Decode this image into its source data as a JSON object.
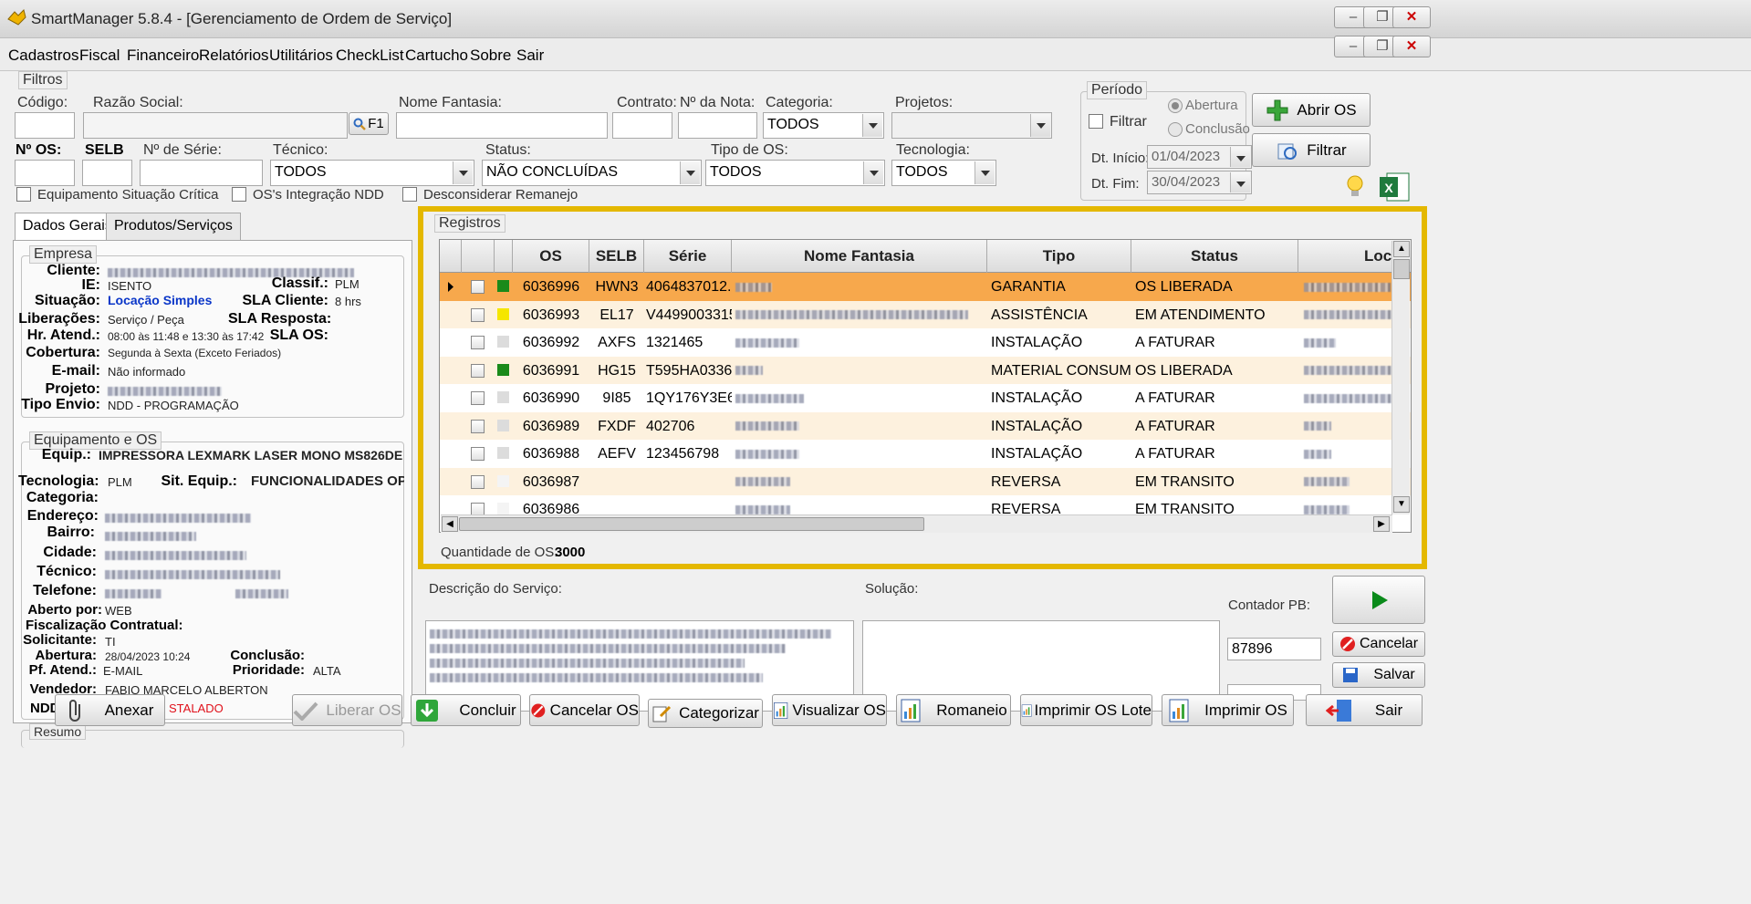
{
  "window": {
    "title": "SmartManager 5.8.4 - [Gerenciamento de Ordem de Serviço]",
    "minimize": "–",
    "restore": "❐",
    "close": "✕"
  },
  "menu": [
    "Cadastros",
    "Fiscal",
    "Financeiro",
    "Relatórios",
    "Utilitários",
    "CheckList",
    "Cartucho",
    "Sobre",
    "Sair"
  ],
  "filters": {
    "legend": "Filtros",
    "codigo_label": "Código:",
    "razao_label": "Razão Social:",
    "f1_label": "F1",
    "fantasia_label": "Nome Fantasia:",
    "contrato_label": "Contrato:",
    "nota_label": "Nº da Nota:",
    "categoria_label": "Categoria:",
    "categoria_value": "TODOS",
    "projetos_label": "Projetos:",
    "nos_label": "Nº OS:",
    "selb_label": "SELB",
    "serie_label": "Nº de Série:",
    "tecnico_label": "Técnico:",
    "tecnico_value": "TODOS",
    "status_label": "Status:",
    "status_value": "NÃO CONCLUÍDAS",
    "tipo_label": "Tipo de OS:",
    "tipo_value": "TODOS",
    "tecnologia_label": "Tecnologia:",
    "tecnologia_value": "TODOS",
    "chk_critica": "Equipamento Situação Crítica",
    "chk_ndd": "OS's Integração NDD",
    "chk_remanejo": "Desconsiderar Remanejo"
  },
  "periodo": {
    "legend": "Período",
    "filtrar_label": "Filtrar",
    "abertura": "Abertura",
    "conclusao": "Conclusão",
    "inicio_label": "Dt. Início:",
    "inicio_value": "01/04/2023",
    "fim_label": "Dt. Fim:",
    "fim_value": "30/04/2023"
  },
  "buttons": {
    "abrir_os": "Abrir OS",
    "filtrar": "Filtrar",
    "anexar": "Anexar",
    "liberar_os": "Liberar OS",
    "concluir": "Concluir",
    "cancelar_os": "Cancelar OS",
    "categorizar": "Categorizar",
    "visualizar_os": "Visualizar OS",
    "romaneio": "Romaneio",
    "imprimir_lote": "Imprimir OS Lote",
    "imprimir_os": "Imprimir OS",
    "sair": "Sair",
    "cancelar": "Cancelar",
    "salvar": "Salvar"
  },
  "tabs": [
    "Dados Gerais",
    "Produtos/Serviços"
  ],
  "empresa": {
    "legend": "Empresa",
    "cliente_label": "Cliente:",
    "ie_label": "IE:",
    "ie_value": "ISENTO",
    "classif_label": "Classif.:",
    "classif_value": "PLM",
    "situacao_label": "Situação:",
    "situacao_value": "Locação Simples",
    "sla_cliente_label": "SLA Cliente:",
    "sla_cliente_value": "8 hrs",
    "liberacoes_label": "Liberações:",
    "liberacoes_value": "Serviço / Peça",
    "sla_resposta_label": "SLA Resposta:",
    "hr_atend_label": "Hr. Atend.:",
    "hr_atend_value": "08:00 às 11:48 e 13:30 às 17:42",
    "sla_os_label": "SLA OS:",
    "cobertura_label": "Cobertura:",
    "cobertura_value": "Segunda à Sexta (Exceto Feriados)",
    "email_label": "E-mail:",
    "email_value": "Não informado",
    "projeto_label": "Projeto:",
    "tipo_envio_label": "Tipo Envio:",
    "tipo_envio_value": "NDD - PROGRAMAÇÃO"
  },
  "equipamento": {
    "legend": "Equipamento e OS",
    "equip_label": "Equip.:",
    "equip_value": "IMPRESSORA LEXMARK LASER MONO MS826DE",
    "tecnologia_label": "Tecnologia:",
    "tecnologia_value": "PLM",
    "sit_equip_label": "Sit. Equip.:",
    "sit_equip_value": "FUNCIONALIDADES OPE",
    "categoria_label": "Categoria:",
    "endereco_label": "Endereço:",
    "bairro_label": "Bairro:",
    "cidade_label": "Cidade:",
    "tecnico_label": "Técnico:",
    "telefone_label": "Telefone:",
    "aberto_por_label": "Aberto por:",
    "aberto_por_value": "WEB",
    "fiscalizacao_label": "Fiscalização Contratual:",
    "solicitante_label": "Solicitante:",
    "solicitante_value": "TI",
    "abertura_label": "Abertura:",
    "abertura_value": "28/04/2023 10:24",
    "conclusao_label": "Conclusão:",
    "pf_atend_label": "Pf. Atend.:",
    "pf_atend_value": "E-MAIL",
    "prioridade_label": "Prioridade:",
    "prioridade_value": "ALTA",
    "vendedor_label": "Vendedor:",
    "vendedor_value": "FABIO MARCELO ALBERTON",
    "ndd_label": "NDD",
    "ndd_value": "STALADO",
    "resumo_legend": "Resumo"
  },
  "registros": {
    "legend": "Registros",
    "columns": [
      "OS",
      "SELB",
      "Série",
      "Nome Fantasia",
      "Tipo",
      "Status",
      "Loca"
    ],
    "rows": [
      {
        "os": "6036996",
        "selb": "HWN3",
        "serie": "4064837012...",
        "tipo": "GARANTIA",
        "status": "OS LIBERADA",
        "color": "#1a8a1a",
        "selected": true
      },
      {
        "os": "6036993",
        "selb": "EL17",
        "serie": "V4499003315",
        "tipo": "ASSISTÊNCIA",
        "status": "EM ATENDIMENTO",
        "color": "#f5e600",
        "selected": false
      },
      {
        "os": "6036992",
        "selb": "AXFS",
        "serie": "1321465",
        "tipo": "INSTALAÇÃO",
        "status": "A FATURAR",
        "color": "#dcdcdc",
        "selected": false
      },
      {
        "os": "6036991",
        "selb": "HG15",
        "serie": "T595HA0336...",
        "tipo": "MATERIAL CONSUMO",
        "status": "OS LIBERADA",
        "color": "#1a8a1a",
        "selected": false
      },
      {
        "os": "6036990",
        "selb": "9I85",
        "serie": "1QY176Y3E6...",
        "tipo": "INSTALAÇÃO",
        "status": "A FATURAR",
        "color": "#dcdcdc",
        "selected": false
      },
      {
        "os": "6036989",
        "selb": "FXDF",
        "serie": "402706",
        "tipo": "INSTALAÇÃO",
        "status": "A FATURAR",
        "color": "#dcdcdc",
        "selected": false
      },
      {
        "os": "6036988",
        "selb": "AEFV",
        "serie": "123456798",
        "tipo": "INSTALAÇÃO",
        "status": "A FATURAR",
        "color": "#dcdcdc",
        "selected": false
      },
      {
        "os": "6036987",
        "selb": "",
        "serie": "",
        "tipo": "REVERSA",
        "status": "EM TRANSITO",
        "color": "#f4f4f4",
        "selected": false
      },
      {
        "os": "6036986",
        "selb": "",
        "serie": "",
        "tipo": "REVERSA",
        "status": "EM TRANSITO",
        "color": "#f4f4f4",
        "selected": false
      }
    ],
    "quantidade_label": "Quantidade de OS:",
    "quantidade_value": "3000"
  },
  "bottom": {
    "descricao_label": "Descrição do Serviço:",
    "solucao_label": "Solução:",
    "contador_label": "Contador PB:",
    "contador_value": "87896"
  },
  "colors": {
    "highlight": "#e4b800",
    "selected_row": "#f7a84c",
    "alt_row": "#fdf1de"
  }
}
